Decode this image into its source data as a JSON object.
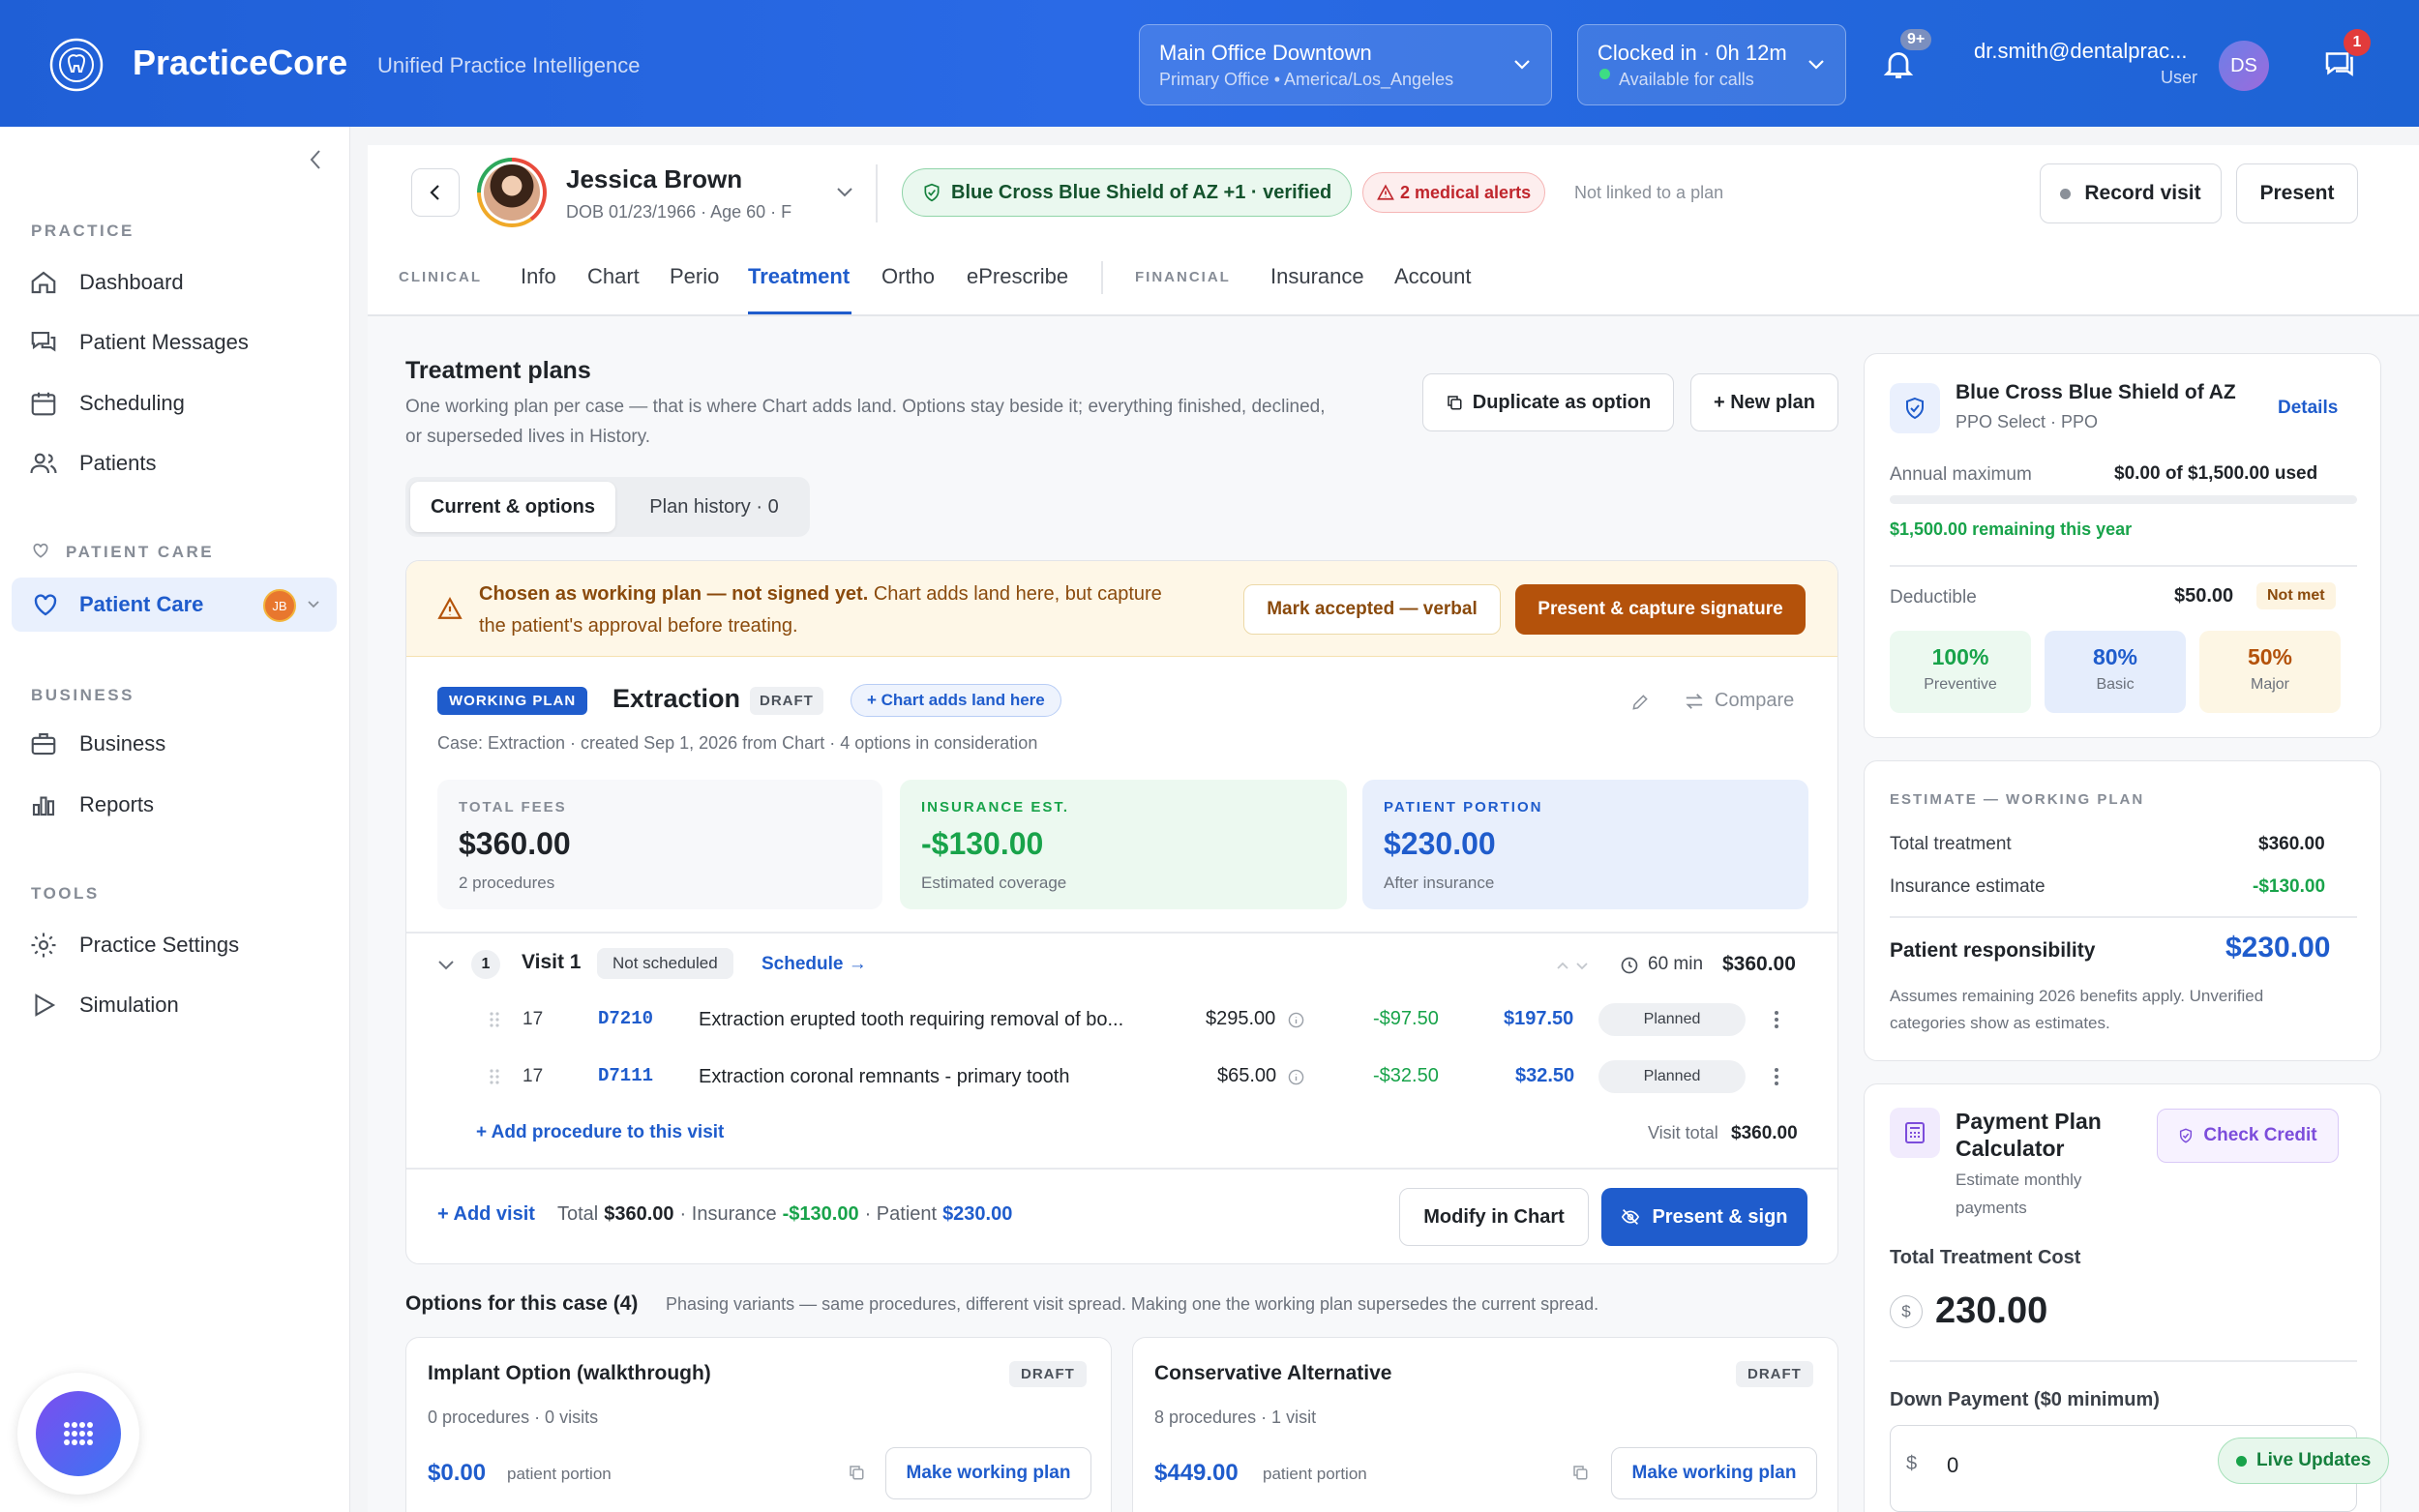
{
  "app": {
    "name": "PracticeCore",
    "tagline": "Unified Practice Intelligence"
  },
  "header": {
    "office": {
      "name": "Main Office Downtown",
      "sub": "Primary Office • America/Los_Angeles"
    },
    "clock": {
      "title": "Clocked in · 0h 12m",
      "sub": "Available for calls"
    },
    "notif_badge": "9+",
    "user": {
      "email": "dr.smith@dentalprac...",
      "role": "User",
      "initials": "DS"
    },
    "chat_badge": "1"
  },
  "sidebar": {
    "practice_label": "PRACTICE",
    "practice": [
      "Dashboard",
      "Patient Messages",
      "Scheduling",
      "Patients"
    ],
    "patient_care_label": "PATIENT CARE",
    "patient_care_item": "Patient Care",
    "patient_care_avatar": "JB",
    "business_label": "BUSINESS",
    "business": [
      "Business",
      "Reports"
    ],
    "tools_label": "TOOLS",
    "tools": [
      "Practice Settings",
      "Simulation"
    ]
  },
  "patient": {
    "name": "Jessica Brown",
    "meta": "DOB 01/23/1966 · Age 60 · F",
    "insurance_badge": "Blue Cross Blue Shield of AZ +1 · verified",
    "alerts": "2 medical alerts",
    "plan_link": "Not linked to a plan",
    "record_visit": "Record visit",
    "present": "Present"
  },
  "tabs": {
    "clinical_label": "CLINICAL",
    "clinical": [
      "Info",
      "Chart",
      "Perio",
      "Treatment",
      "Ortho",
      "ePrescribe"
    ],
    "active": "Treatment",
    "financial_label": "FINANCIAL",
    "financial": [
      "Insurance",
      "Account"
    ]
  },
  "plans": {
    "title": "Treatment plans",
    "desc1": "One working plan per case — that is where Chart adds land. Options stay beside it; everything finished, declined,",
    "desc2": "or superseded lives in History.",
    "duplicate": "Duplicate as option",
    "new_plan": "+ New plan",
    "seg_current": "Current & options",
    "seg_history": "Plan history · 0",
    "warning_bold": "Chosen as working plan — not signed yet.",
    "warning_rest1": " Chart adds land here, but capture",
    "warning_rest2": "the patient's approval before treating.",
    "mark_verbal": "Mark accepted — verbal",
    "present_capture": "Present & capture signature"
  },
  "working": {
    "badge": "WORKING PLAN",
    "name": "Extraction",
    "status": "DRAFT",
    "chart_adds": "+ Chart adds land here",
    "compare": "Compare",
    "case": "Case: Extraction · created Sep 1, 2026 from Chart · 4 options in consideration",
    "total_label": "TOTAL FEES",
    "total": "$360.00",
    "total_sub": "2 procedures",
    "ins_label": "INSURANCE EST.",
    "ins": "-$130.00",
    "ins_sub": "Estimated coverage",
    "pat_label": "PATIENT PORTION",
    "pat": "$230.00",
    "pat_sub": "After insurance",
    "visit": {
      "num": "1",
      "title": "Visit 1",
      "status": "Not scheduled",
      "schedule": "Schedule →",
      "duration": "60 min",
      "total": "$360.00"
    },
    "procedures": [
      {
        "tooth": "17",
        "code": "D7210",
        "desc": "Extraction erupted tooth requiring removal of bo...",
        "fee": "$295.00",
        "ins": "-$97.50",
        "pat": "$197.50",
        "status": "Planned"
      },
      {
        "tooth": "17",
        "code": "D7111",
        "desc": "Extraction coronal remnants - primary tooth",
        "fee": "$65.00",
        "ins": "-$32.50",
        "pat": "$32.50",
        "status": "Planned"
      }
    ],
    "add_proc": "+ Add procedure to this visit",
    "visit_total_label": "Visit total",
    "visit_total": "$360.00",
    "add_visit": "+ Add visit",
    "foot_total_label": "Total",
    "foot_total": "$360.00",
    "foot_ins_label": "· Insurance",
    "foot_ins": "-$130.00",
    "foot_pat_label": "· Patient",
    "foot_pat": "$230.00",
    "modify": "Modify in Chart",
    "present_sign": "Present & sign"
  },
  "options": {
    "title": "Options for this case (4)",
    "desc": "Phasing variants — same procedures, different visit spread. Making one the working plan supersedes the current spread.",
    "items": [
      {
        "name": "Implant Option (walkthrough)",
        "status": "DRAFT",
        "meta": "0 procedures · 0 visits",
        "amount": "$0.00",
        "amount_label": "patient portion",
        "action": "Make working plan"
      },
      {
        "name": "Conservative Alternative",
        "status": "DRAFT",
        "meta": "8 procedures · 1 visit",
        "amount": "$449.00",
        "amount_label": "patient portion",
        "action": "Make working plan"
      }
    ]
  },
  "insurance_card": {
    "name": "Blue Cross Blue Shield of AZ",
    "plan": "PPO Select · PPO",
    "details": "Details",
    "annual_label": "Annual maximum",
    "annual_value": "$0.00 of $1,500.00 used",
    "annual_used_fraction": 0,
    "remaining": "$1,500.00 remaining this year",
    "deductible_label": "Deductible",
    "deductible_value": "$50.00",
    "deductible_status": "Not met",
    "coverage": [
      {
        "pct": "100%",
        "label": "Preventive"
      },
      {
        "pct": "80%",
        "label": "Basic"
      },
      {
        "pct": "50%",
        "label": "Major"
      }
    ]
  },
  "estimate": {
    "label": "ESTIMATE — WORKING PLAN",
    "total_label": "Total treatment",
    "total": "$360.00",
    "ins_label": "Insurance estimate",
    "ins": "-$130.00",
    "resp_label": "Patient responsibility",
    "resp": "$230.00",
    "note1": "Assumes remaining 2026 benefits apply. Unverified",
    "note2": "categories show as estimates."
  },
  "payment": {
    "title1": "Payment Plan",
    "title2": "Calculator",
    "sub1": "Estimate monthly",
    "sub2": "payments",
    "check_credit": "Check Credit",
    "total_label": "Total Treatment Cost",
    "currency": "$",
    "total": "230.00",
    "down_label": "Down Payment ($0 minimum)",
    "down_value": "0",
    "live": "Live Updates"
  }
}
